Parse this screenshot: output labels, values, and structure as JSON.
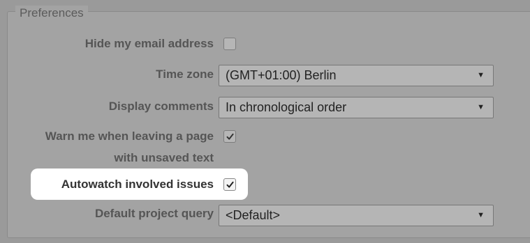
{
  "preferences": {
    "legend": "Preferences",
    "hide_email": {
      "label": "Hide my email address",
      "checked": false
    },
    "time_zone": {
      "label": "Time zone",
      "value": "(GMT+01:00) Berlin"
    },
    "display_comments": {
      "label": "Display comments",
      "value": "In chronological order"
    },
    "warn_unsaved": {
      "label_line1": "Warn me when leaving a page",
      "label_line2": "with unsaved text",
      "checked": true
    },
    "autowatch": {
      "label": "Autowatch involved issues",
      "checked": true
    },
    "default_query": {
      "label": "Default project query",
      "value": "<Default>"
    }
  },
  "icons": {
    "dropdown": "triangle-down-icon",
    "check": "checkmark-icon"
  },
  "colors": {
    "highlight": "#ffffff",
    "background": "#9a9a9a"
  }
}
